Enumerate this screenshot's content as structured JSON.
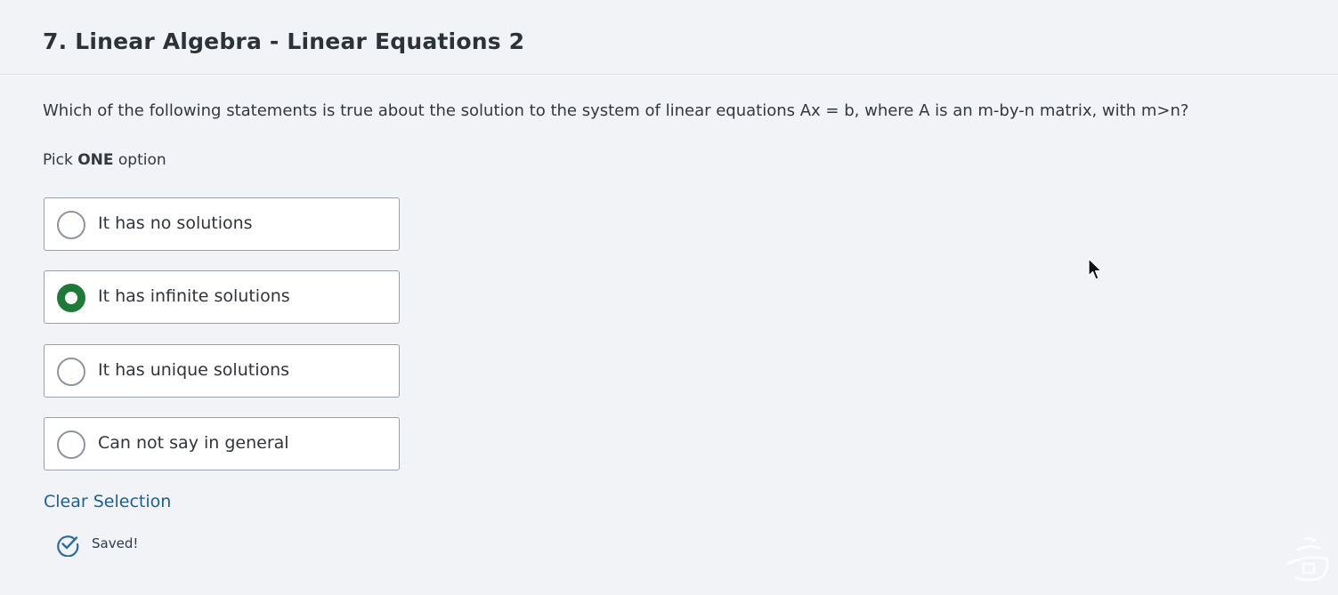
{
  "question": {
    "title": "7. Linear Algebra - Linear Equations 2",
    "text": "Which of the following statements is true about the solution to the system of linear equations Ax = b, where A is an m-by-n matrix, with m>n?",
    "instruction_prefix": "Pick ",
    "instruction_emphasis": "ONE",
    "instruction_suffix": " option"
  },
  "options": [
    {
      "label": "It has no solutions",
      "selected": false
    },
    {
      "label": "It has infinite solutions",
      "selected": true
    },
    {
      "label": "It has unique solutions",
      "selected": false
    },
    {
      "label": "Can not say in general",
      "selected": false
    }
  ],
  "actions": {
    "clear_label": "Clear Selection"
  },
  "status": {
    "saved_label": "Saved!",
    "saved_icon": "check-circle-icon"
  },
  "colors": {
    "accent_green": "#1f7a3a",
    "link_blue": "#1f5f8f"
  }
}
